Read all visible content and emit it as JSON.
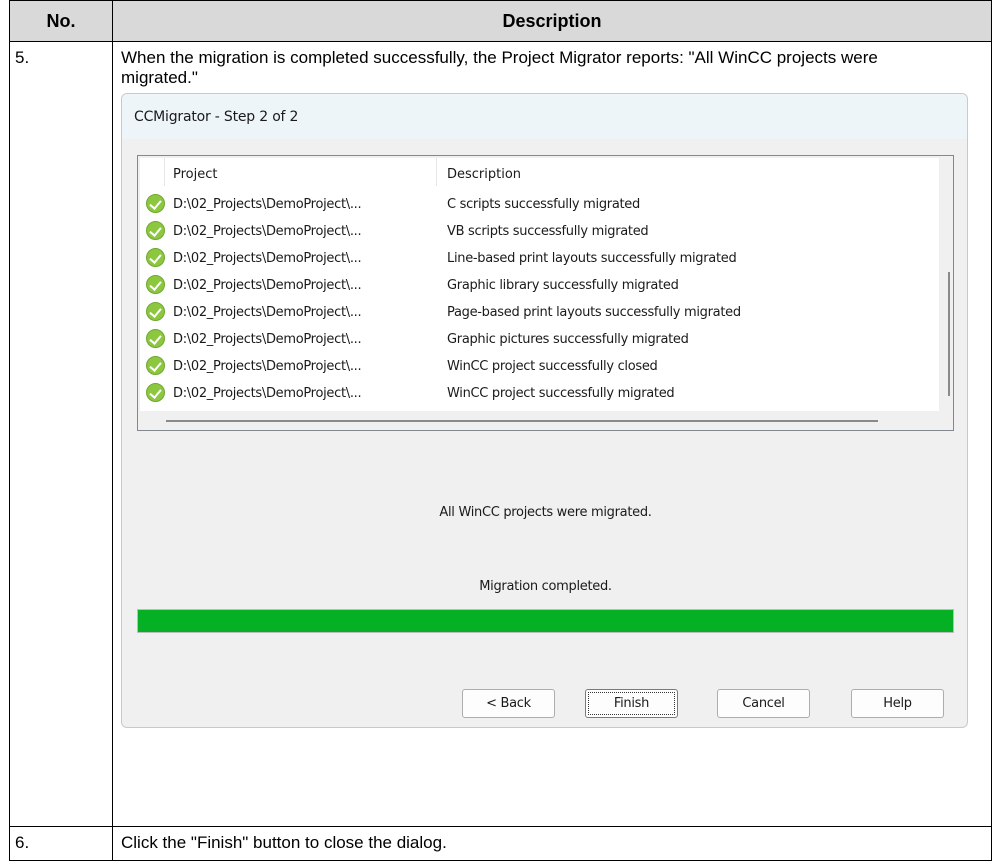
{
  "table": {
    "header_no": "No.",
    "header_description": "Description"
  },
  "step5": {
    "number": "5.",
    "text": "When the migration is completed successfully, the Project Migrator reports: \"All WinCC projects were migrated.\""
  },
  "dialog": {
    "title": "CCMigrator - Step 2 of 2",
    "list": {
      "col_project": "Project",
      "col_description": "Description",
      "rows": [
        {
          "project": "D:\\02_Projects\\DemoProject\\...",
          "description": "C scripts successfully migrated"
        },
        {
          "project": "D:\\02_Projects\\DemoProject\\...",
          "description": "VB scripts successfully migrated"
        },
        {
          "project": "D:\\02_Projects\\DemoProject\\...",
          "description": "Line-based print layouts successfully migrated"
        },
        {
          "project": "D:\\02_Projects\\DemoProject\\...",
          "description": "Graphic library successfully migrated"
        },
        {
          "project": "D:\\02_Projects\\DemoProject\\...",
          "description": "Page-based print layouts successfully migrated"
        },
        {
          "project": "D:\\02_Projects\\DemoProject\\...",
          "description": "Graphic pictures successfully migrated"
        },
        {
          "project": "D:\\02_Projects\\DemoProject\\...",
          "description": "WinCC project successfully closed"
        },
        {
          "project": "D:\\02_Projects\\DemoProject\\...",
          "description": "WinCC project successfully migrated"
        }
      ],
      "row_icon": "check-circle-icon"
    },
    "status_all": "All WinCC projects were migrated.",
    "status_done": "Migration completed.",
    "progress_percent": 100,
    "progress_color": "#06b025",
    "buttons": {
      "back": "< Back",
      "finish": "Finish",
      "cancel": "Cancel",
      "help": "Help"
    }
  },
  "step6": {
    "number": "6.",
    "text": "Click the \"Finish\" button to close the dialog."
  }
}
